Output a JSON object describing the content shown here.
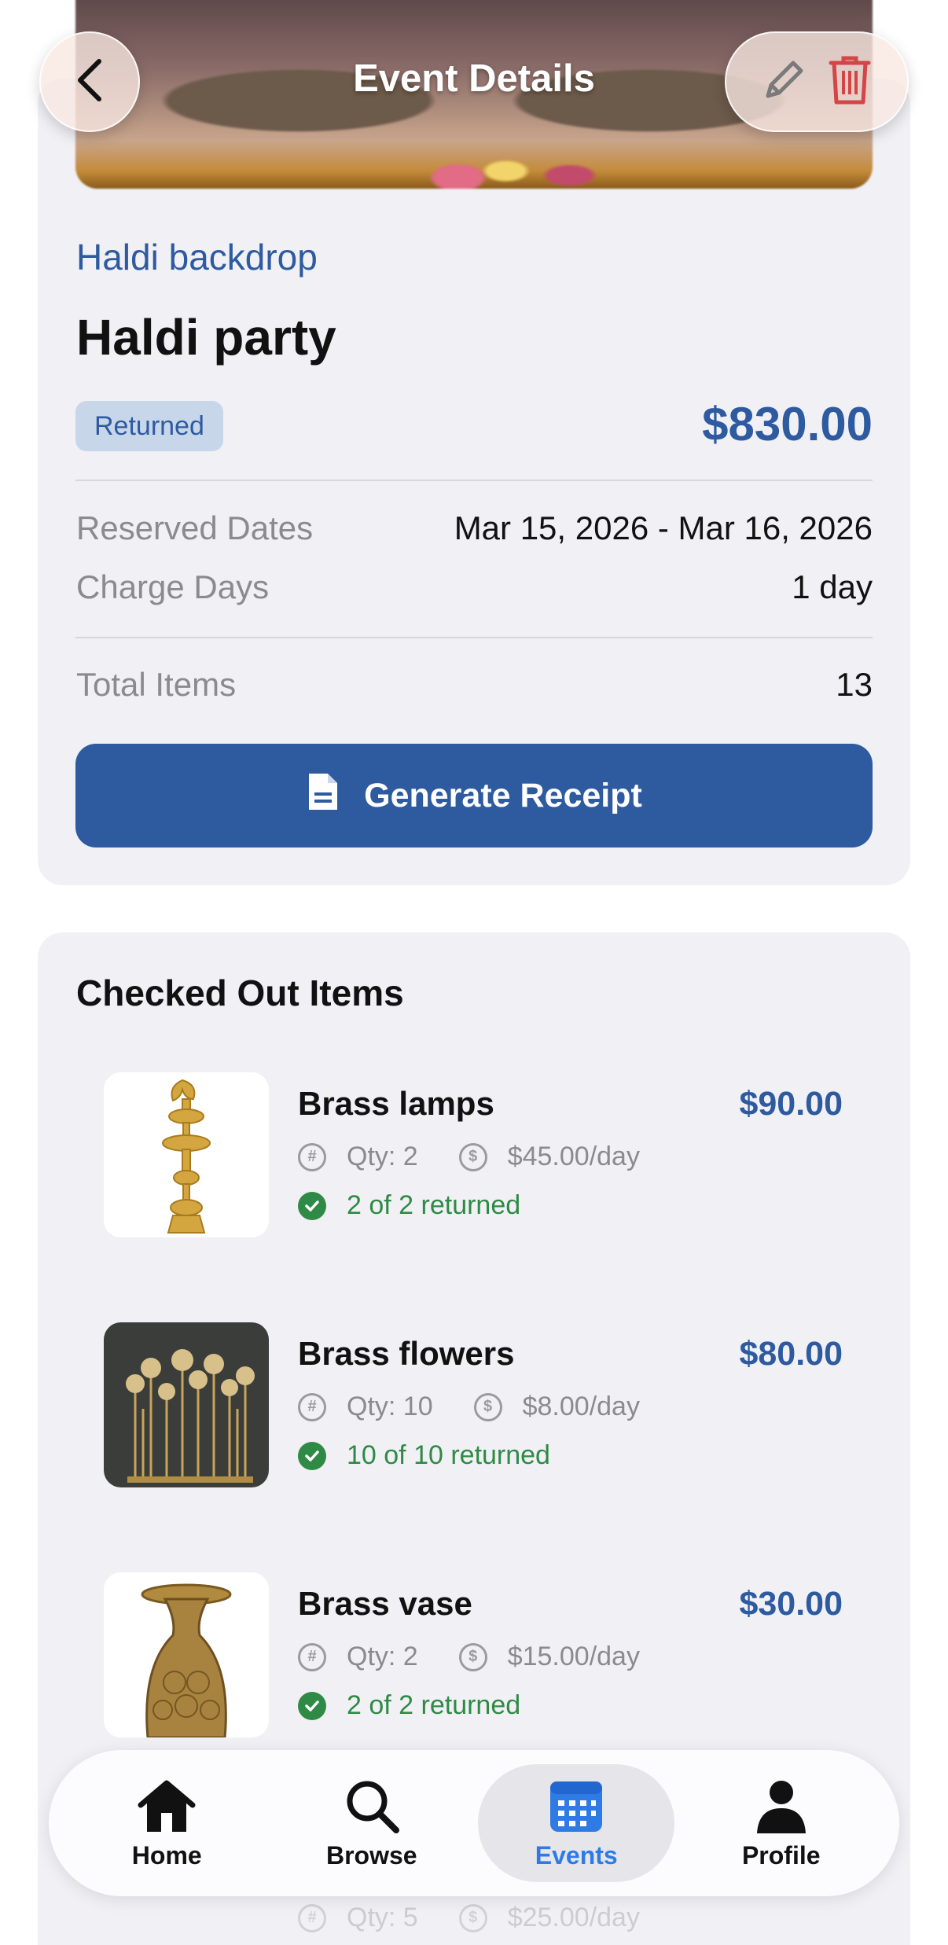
{
  "header": {
    "title": "Event Details"
  },
  "event": {
    "subtitle": "Haldi backdrop",
    "title": "Haldi party",
    "status": "Returned",
    "total": "$830.00",
    "reserved_label": "Reserved Dates",
    "reserved_value": "Mar 15, 2026 - Mar 16, 2026",
    "charge_label": "Charge Days",
    "charge_value": "1 day",
    "items_label": "Total Items",
    "items_value": "13",
    "receipt_button": "Generate Receipt"
  },
  "checked_out": {
    "title": "Checked Out Items",
    "items": [
      {
        "name": "Brass lamps",
        "price": "$90.00",
        "qty": "Qty: 2",
        "rate": "$45.00/day",
        "returned": "2 of 2 returned"
      },
      {
        "name": "Brass flowers",
        "price": "$80.00",
        "qty": "Qty: 10",
        "rate": "$8.00/day",
        "returned": "10 of 10 returned"
      },
      {
        "name": "Brass vase",
        "price": "$30.00",
        "qty": "Qty: 2",
        "rate": "$15.00/day",
        "returned": "2 of 2 returned"
      },
      {
        "qty": "Qty: 5",
        "rate": "$25.00/day"
      }
    ]
  },
  "tabbar": {
    "tabs": [
      {
        "label": "Home",
        "icon": "home-icon"
      },
      {
        "label": "Browse",
        "icon": "search-icon"
      },
      {
        "label": "Events",
        "icon": "calendar-icon",
        "active": true
      },
      {
        "label": "Profile",
        "icon": "person-icon"
      }
    ]
  },
  "colors": {
    "accent": "#2e5aa0",
    "success": "#2e8a44",
    "danger": "#d64545",
    "active_tab": "#2e7be6"
  }
}
